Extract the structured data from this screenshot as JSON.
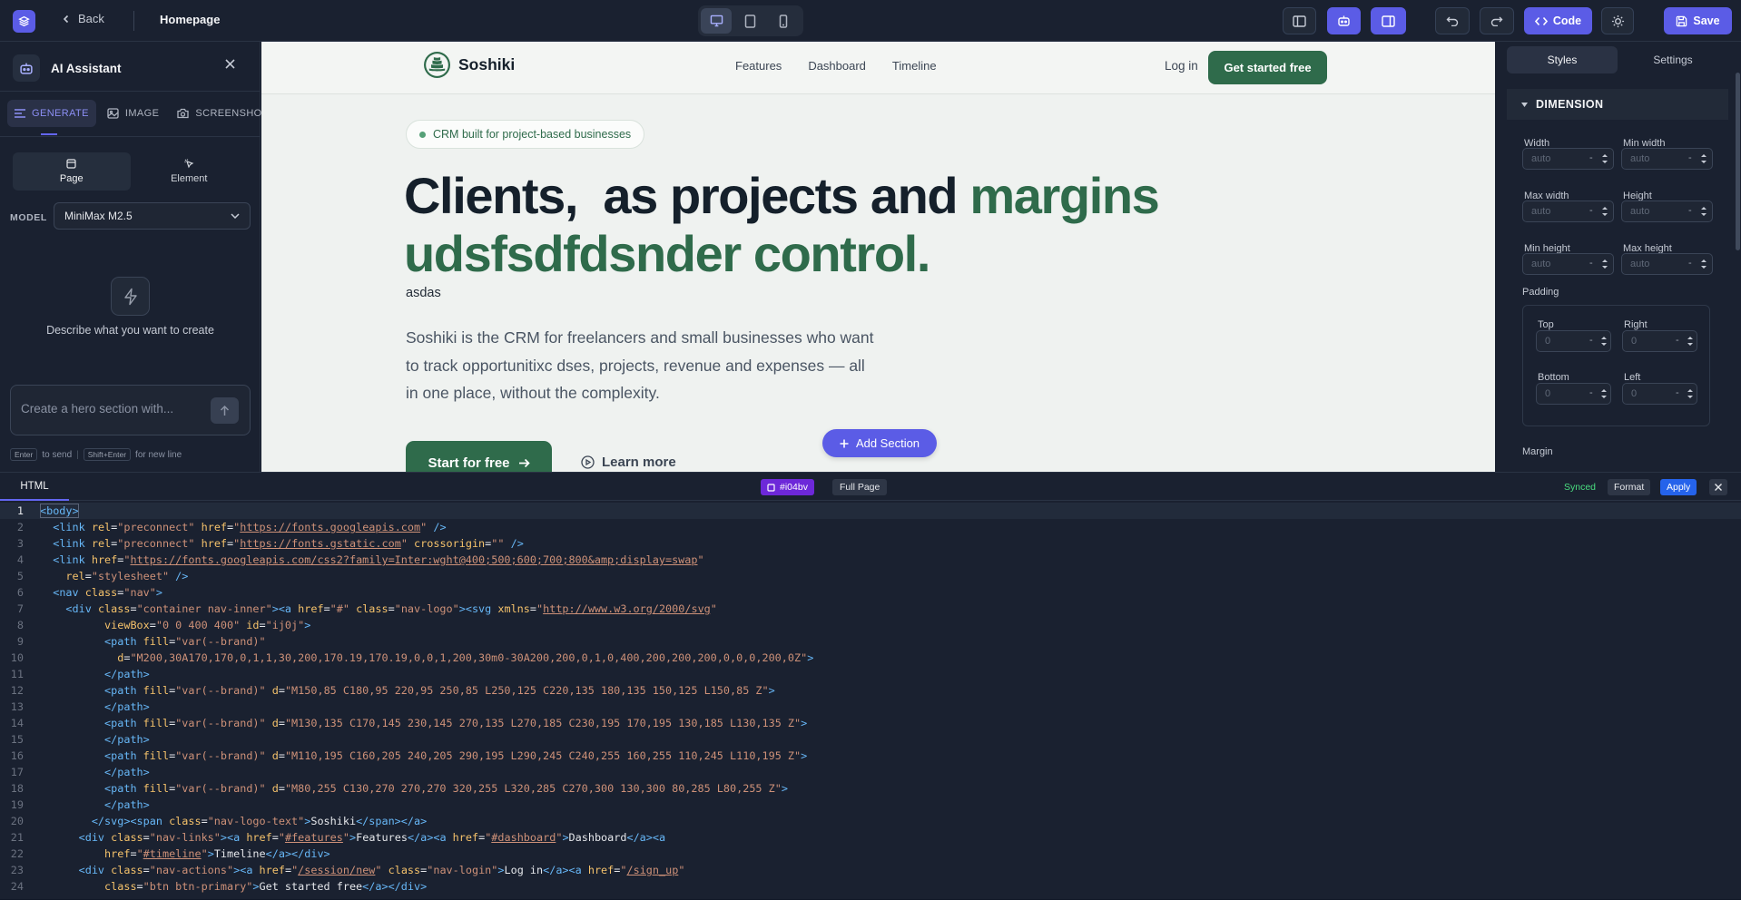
{
  "topbar": {
    "back_label": "Back",
    "page_title": "Homepage",
    "code_label": "Code",
    "save_label": "Save"
  },
  "ai_panel": {
    "title": "AI Assistant",
    "modes": [
      "GENERATE",
      "IMAGE",
      "SCREENSHOT"
    ],
    "targets": [
      "Page",
      "Element"
    ],
    "model_label": "MODEL",
    "model_value": "MiniMax M2.5",
    "empty_text": "Describe what you want to create",
    "prompt_placeholder": "Create a hero section with...",
    "hint": {
      "enter_key": "Enter",
      "enter_text": "to send",
      "shift_key": "Shift+Enter",
      "shift_text": "for new line"
    }
  },
  "site": {
    "brand": "Soshiki",
    "nav_links": [
      "Features",
      "Dashboard",
      "Timeline"
    ],
    "login": "Log in",
    "cta": "Get started free",
    "pill": "CRM built for project-based businesses",
    "hero_line1_dark": "Clients,  as projects and ",
    "hero_line1_accent": "margins",
    "hero_line2_accent": "udsfsdfdsnder control.",
    "hero_sub": "asdas",
    "hero_paragraph": "Soshiki is the CRM for freelancers and small businesses who want to track opportunitixc dses, projects, revenue and expenses — all in one place, without the complexity.",
    "btn_start": "Start for free",
    "btn_learn": "Learn more",
    "add_section": "Add Section"
  },
  "styles_panel": {
    "tabs": [
      "Styles",
      "Settings"
    ],
    "section": "DIMENSION",
    "width": "Width",
    "min_width": "Min width",
    "max_width": "Max width",
    "height": "Height",
    "min_height": "Min height",
    "max_height": "Max height",
    "auto_placeholder": "auto",
    "unit": "-",
    "padding": "Padding",
    "top": "Top",
    "right": "Right",
    "bottom": "Bottom",
    "left": "Left",
    "zero_placeholder": "0",
    "margin": "Margin"
  },
  "code_panel": {
    "tab": "HTML",
    "selection": "#i04bv",
    "full_page": "Full Page",
    "status": "Synced",
    "format": "Format",
    "apply": "Apply",
    "lines": [
      [
        [
          "tg",
          "<body>"
        ]
      ],
      [
        [
          "t",
          "  "
        ],
        [
          "tg",
          "<link "
        ],
        [
          "at",
          "rel"
        ],
        [
          "ct",
          "="
        ],
        [
          "st",
          "\"preconnect\" "
        ],
        [
          "at",
          "href"
        ],
        [
          "ct",
          "="
        ],
        [
          "st",
          "\""
        ],
        [
          "ul",
          "https://fonts.googleapis.com"
        ],
        [
          "st",
          "\""
        ],
        [
          "tg",
          " />"
        ]
      ],
      [
        [
          "t",
          "  "
        ],
        [
          "tg",
          "<link "
        ],
        [
          "at",
          "rel"
        ],
        [
          "ct",
          "="
        ],
        [
          "st",
          "\"preconnect\" "
        ],
        [
          "at",
          "href"
        ],
        [
          "ct",
          "="
        ],
        [
          "st",
          "\""
        ],
        [
          "ul",
          "https://fonts.gstatic.com"
        ],
        [
          "st",
          "\" "
        ],
        [
          "at",
          "crossorigin"
        ],
        [
          "ct",
          "="
        ],
        [
          "st",
          "\"\""
        ],
        [
          "tg",
          " />"
        ]
      ],
      [
        [
          "t",
          "  "
        ],
        [
          "tg",
          "<link "
        ],
        [
          "at",
          "href"
        ],
        [
          "ct",
          "="
        ],
        [
          "st",
          "\""
        ],
        [
          "ul",
          "https://fonts.googleapis.com/css2?family=Inter:wght@400;500;600;700;800&amp;display=swap"
        ],
        [
          "st",
          "\""
        ]
      ],
      [
        [
          "t",
          "    "
        ],
        [
          "at",
          "rel"
        ],
        [
          "ct",
          "="
        ],
        [
          "st",
          "\"stylesheet\""
        ],
        [
          "tg",
          " />"
        ]
      ],
      [
        [
          "t",
          "  "
        ],
        [
          "tg",
          "<nav "
        ],
        [
          "at",
          "class"
        ],
        [
          "ct",
          "="
        ],
        [
          "st",
          "\"nav\""
        ],
        [
          "tg",
          ">"
        ]
      ],
      [
        [
          "t",
          "    "
        ],
        [
          "tg",
          "<div "
        ],
        [
          "at",
          "class"
        ],
        [
          "ct",
          "="
        ],
        [
          "st",
          "\"container nav-inner\""
        ],
        [
          "tg",
          "><a "
        ],
        [
          "at",
          "href"
        ],
        [
          "ct",
          "="
        ],
        [
          "st",
          "\"#\" "
        ],
        [
          "at",
          "class"
        ],
        [
          "ct",
          "="
        ],
        [
          "st",
          "\"nav-logo\""
        ],
        [
          "tg",
          "><svg "
        ],
        [
          "at",
          "xmlns"
        ],
        [
          "ct",
          "="
        ],
        [
          "st",
          "\""
        ],
        [
          "ul",
          "http://www.w3.org/2000/svg"
        ],
        [
          "st",
          "\""
        ]
      ],
      [
        [
          "t",
          "          "
        ],
        [
          "at",
          "viewBox"
        ],
        [
          "ct",
          "="
        ],
        [
          "st",
          "\"0 0 400 400\" "
        ],
        [
          "at",
          "id"
        ],
        [
          "ct",
          "="
        ],
        [
          "st",
          "\"ij0j\""
        ],
        [
          "tg",
          ">"
        ]
      ],
      [
        [
          "t",
          "          "
        ],
        [
          "tg",
          "<path "
        ],
        [
          "at",
          "fill"
        ],
        [
          "ct",
          "="
        ],
        [
          "st",
          "\"var(--brand)\""
        ]
      ],
      [
        [
          "t",
          "            "
        ],
        [
          "at",
          "d"
        ],
        [
          "ct",
          "="
        ],
        [
          "st",
          "\"M200,30A170,170,0,1,1,30,200,170.19,170.19,0,0,1,200,30m0-30A200,200,0,1,0,400,200,200,200,0,0,0,200,0Z\""
        ],
        [
          "tg",
          ">"
        ]
      ],
      [
        [
          "t",
          "          "
        ],
        [
          "tg",
          "</path>"
        ]
      ],
      [
        [
          "t",
          "          "
        ],
        [
          "tg",
          "<path "
        ],
        [
          "at",
          "fill"
        ],
        [
          "ct",
          "="
        ],
        [
          "st",
          "\"var(--brand)\" "
        ],
        [
          "at",
          "d"
        ],
        [
          "ct",
          "="
        ],
        [
          "st",
          "\"M150,85 C180,95 220,95 250,85 L250,125 C220,135 180,135 150,125 L150,85 Z\""
        ],
        [
          "tg",
          ">"
        ]
      ],
      [
        [
          "t",
          "          "
        ],
        [
          "tg",
          "</path>"
        ]
      ],
      [
        [
          "t",
          "          "
        ],
        [
          "tg",
          "<path "
        ],
        [
          "at",
          "fill"
        ],
        [
          "ct",
          "="
        ],
        [
          "st",
          "\"var(--brand)\" "
        ],
        [
          "at",
          "d"
        ],
        [
          "ct",
          "="
        ],
        [
          "st",
          "\"M130,135 C170,145 230,145 270,135 L270,185 C230,195 170,195 130,185 L130,135 Z\""
        ],
        [
          "tg",
          ">"
        ]
      ],
      [
        [
          "t",
          "          "
        ],
        [
          "tg",
          "</path>"
        ]
      ],
      [
        [
          "t",
          "          "
        ],
        [
          "tg",
          "<path "
        ],
        [
          "at",
          "fill"
        ],
        [
          "ct",
          "="
        ],
        [
          "st",
          "\"var(--brand)\" "
        ],
        [
          "at",
          "d"
        ],
        [
          "ct",
          "="
        ],
        [
          "st",
          "\"M110,195 C160,205 240,205 290,195 L290,245 C240,255 160,255 110,245 L110,195 Z\""
        ],
        [
          "tg",
          ">"
        ]
      ],
      [
        [
          "t",
          "          "
        ],
        [
          "tg",
          "</path>"
        ]
      ],
      [
        [
          "t",
          "          "
        ],
        [
          "tg",
          "<path "
        ],
        [
          "at",
          "fill"
        ],
        [
          "ct",
          "="
        ],
        [
          "st",
          "\"var(--brand)\" "
        ],
        [
          "at",
          "d"
        ],
        [
          "ct",
          "="
        ],
        [
          "st",
          "\"M80,255 C130,270 270,270 320,255 L320,285 C270,300 130,300 80,285 L80,255 Z\""
        ],
        [
          "tg",
          ">"
        ]
      ],
      [
        [
          "t",
          "          "
        ],
        [
          "tg",
          "</path>"
        ]
      ],
      [
        [
          "t",
          "        "
        ],
        [
          "tg",
          "</svg><span "
        ],
        [
          "at",
          "class"
        ],
        [
          "ct",
          "="
        ],
        [
          "st",
          "\"nav-logo-text\""
        ],
        [
          "tg",
          ">"
        ],
        [
          "ct",
          "Soshiki"
        ],
        [
          "tg",
          "</span></a>"
        ]
      ],
      [
        [
          "t",
          "      "
        ],
        [
          "tg",
          "<div "
        ],
        [
          "at",
          "class"
        ],
        [
          "ct",
          "="
        ],
        [
          "st",
          "\"nav-links\""
        ],
        [
          "tg",
          "><a "
        ],
        [
          "at",
          "href"
        ],
        [
          "ct",
          "="
        ],
        [
          "st",
          "\""
        ],
        [
          "ul",
          "#features"
        ],
        [
          "st",
          "\""
        ],
        [
          "tg",
          ">"
        ],
        [
          "ct",
          "Features"
        ],
        [
          "tg",
          "</a><a "
        ],
        [
          "at",
          "href"
        ],
        [
          "ct",
          "="
        ],
        [
          "st",
          "\""
        ],
        [
          "ul",
          "#dashboard"
        ],
        [
          "st",
          "\""
        ],
        [
          "tg",
          ">"
        ],
        [
          "ct",
          "Dashboard"
        ],
        [
          "tg",
          "</a><a"
        ]
      ],
      [
        [
          "t",
          "          "
        ],
        [
          "at",
          "href"
        ],
        [
          "ct",
          "="
        ],
        [
          "st",
          "\""
        ],
        [
          "ul",
          "#timeline"
        ],
        [
          "st",
          "\""
        ],
        [
          "tg",
          ">"
        ],
        [
          "ct",
          "Timeline"
        ],
        [
          "tg",
          "</a></div>"
        ]
      ],
      [
        [
          "t",
          "      "
        ],
        [
          "tg",
          "<div "
        ],
        [
          "at",
          "class"
        ],
        [
          "ct",
          "="
        ],
        [
          "st",
          "\"nav-actions\""
        ],
        [
          "tg",
          "><a "
        ],
        [
          "at",
          "href"
        ],
        [
          "ct",
          "="
        ],
        [
          "st",
          "\""
        ],
        [
          "ul",
          "/session/new"
        ],
        [
          "st",
          "\" "
        ],
        [
          "at",
          "class"
        ],
        [
          "ct",
          "="
        ],
        [
          "st",
          "\"nav-login\""
        ],
        [
          "tg",
          ">"
        ],
        [
          "ct",
          "Log in"
        ],
        [
          "tg",
          "</a><a "
        ],
        [
          "at",
          "href"
        ],
        [
          "ct",
          "="
        ],
        [
          "st",
          "\""
        ],
        [
          "ul",
          "/sign_up"
        ],
        [
          "st",
          "\""
        ]
      ],
      [
        [
          "t",
          "          "
        ],
        [
          "at",
          "class"
        ],
        [
          "ct",
          "="
        ],
        [
          "st",
          "\"btn btn-primary\""
        ],
        [
          "tg",
          ">"
        ],
        [
          "ct",
          "Get started free"
        ],
        [
          "tg",
          "</a></div>"
        ]
      ]
    ]
  }
}
